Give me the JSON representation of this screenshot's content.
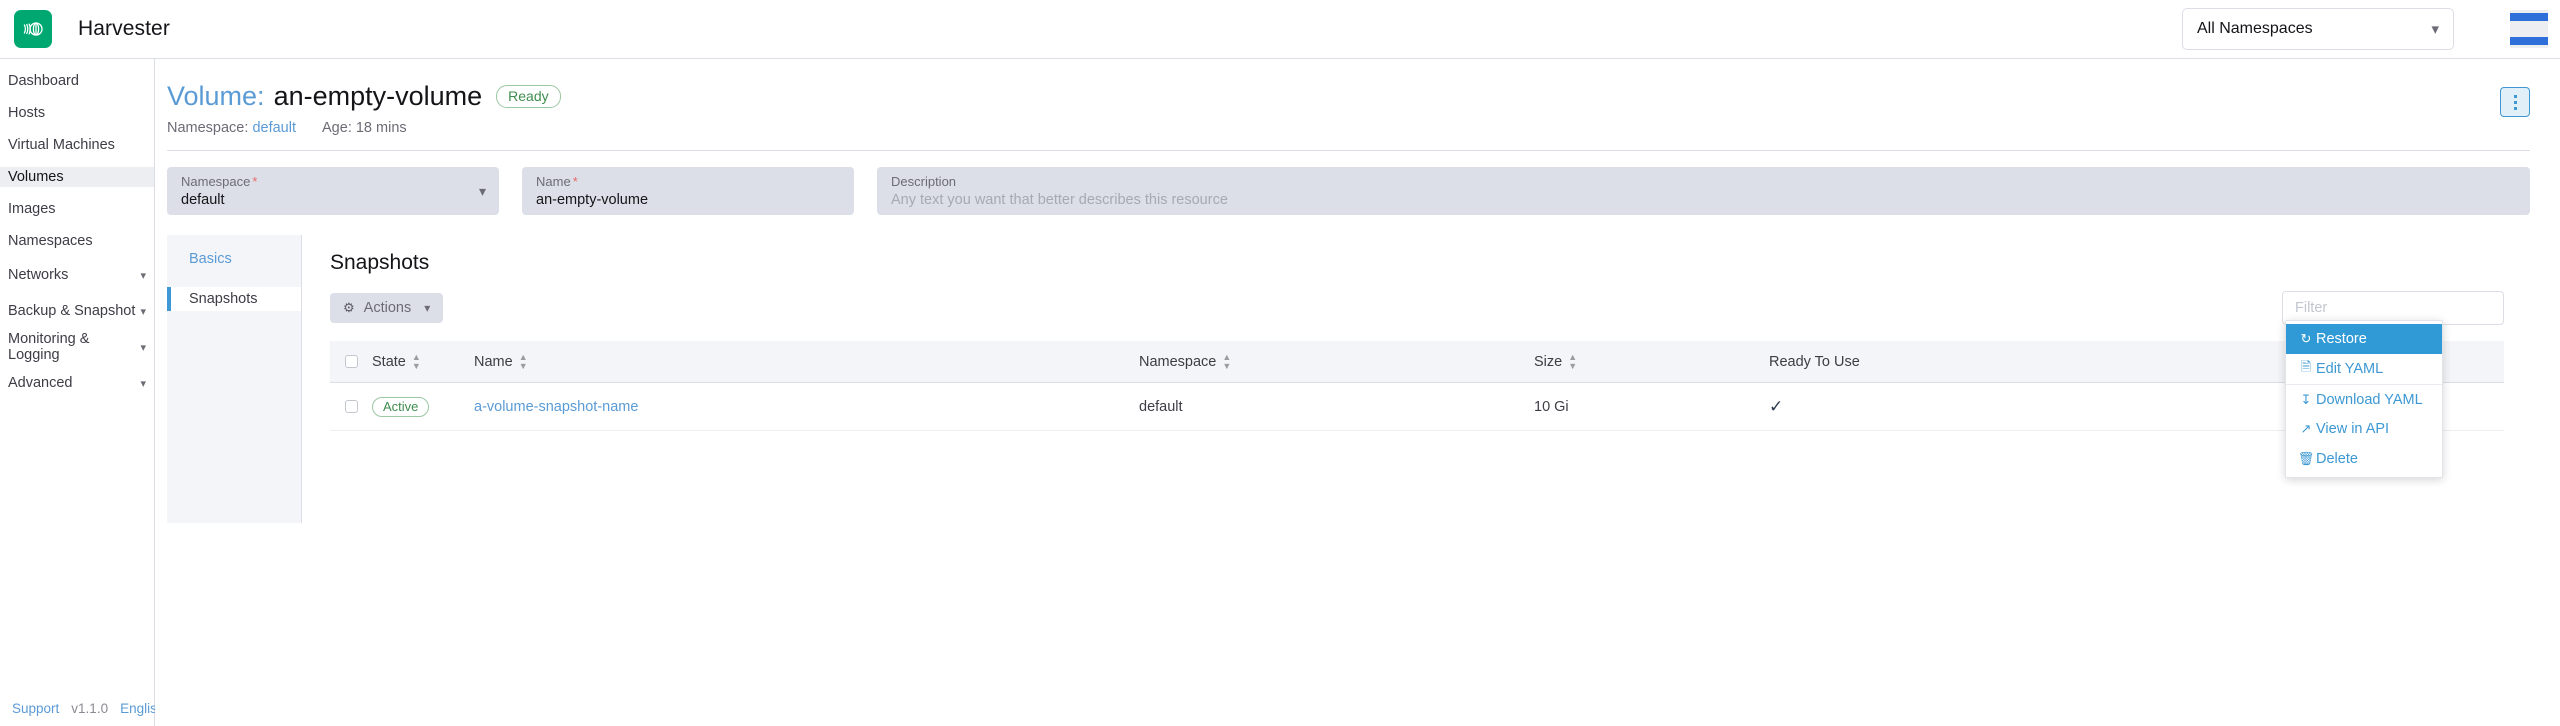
{
  "topbar": {
    "logo_icon": "harvester-logo-icon",
    "brand": "Harvester",
    "namespace_filter": {
      "value": "All Namespaces",
      "chevron_icon": "chevron-down-icon"
    },
    "brand_color": "#00a871"
  },
  "sidebar": {
    "items": [
      {
        "label": "Dashboard",
        "active": false,
        "expandable": false
      },
      {
        "label": "Hosts",
        "active": false,
        "expandable": false
      },
      {
        "label": "Virtual Machines",
        "active": false,
        "expandable": false
      },
      {
        "label": "Volumes",
        "active": true,
        "expandable": false
      },
      {
        "label": "Images",
        "active": false,
        "expandable": false
      },
      {
        "label": "Namespaces",
        "active": false,
        "expandable": false
      },
      {
        "label": "Networks",
        "active": false,
        "expandable": true
      },
      {
        "label": "Backup & Snapshot",
        "active": false,
        "expandable": true
      },
      {
        "label": "Monitoring & Logging",
        "active": false,
        "expandable": true
      },
      {
        "label": "Advanced",
        "active": false,
        "expandable": true
      }
    ],
    "footer": {
      "support": "Support",
      "version": "v1.1.0",
      "language": "English"
    }
  },
  "header": {
    "kind": "Volume:",
    "name": "an-empty-volume",
    "state_badge": "Ready",
    "namespace_label": "Namespace:",
    "namespace_value": "default",
    "age": "Age: 18 mins",
    "kebab_icon": "kebab-menu-icon"
  },
  "form": {
    "namespace": {
      "label": "Namespace",
      "required": "*",
      "value": "default",
      "chevron_icon": "chevron-down-icon"
    },
    "name": {
      "label": "Name",
      "required": "*",
      "value": "an-empty-volume"
    },
    "description": {
      "label": "Description",
      "placeholder": "Any text you want that better describes this resource",
      "value": ""
    }
  },
  "panel": {
    "tabs": [
      {
        "label": "Basics",
        "active": false
      },
      {
        "label": "Snapshots",
        "active": true
      }
    ],
    "title": "Snapshots",
    "actions_button": {
      "label": "Actions",
      "gear_icon": "gear-icon",
      "chevron_icon": "chevron-down-icon"
    },
    "filter": {
      "placeholder": "Filter",
      "value": ""
    }
  },
  "table": {
    "columns": [
      {
        "label": "State",
        "sortable": true
      },
      {
        "label": "Name",
        "sortable": true
      },
      {
        "label": "Namespace",
        "sortable": true
      },
      {
        "label": "Size",
        "sortable": true
      },
      {
        "label": "Ready To Use",
        "sortable": false
      }
    ],
    "rows": [
      {
        "selected": false,
        "state": "Active",
        "name": "a-volume-snapshot-name",
        "namespace": "default",
        "size": "10 Gi",
        "ready_to_use": "✓"
      }
    ]
  },
  "context_menu": {
    "items": [
      {
        "label": "Restore",
        "icon": "restore-icon",
        "selected": true,
        "separator": false
      },
      {
        "label": "Edit YAML",
        "icon": "file-icon",
        "selected": false,
        "separator": false
      },
      {
        "label": "Download YAML",
        "icon": "download-icon",
        "selected": false,
        "separator": true
      },
      {
        "label": "View in API",
        "icon": "external-link-icon",
        "selected": false,
        "separator": false
      },
      {
        "label": "Delete",
        "icon": "trash-icon",
        "selected": false,
        "separator": false
      }
    ]
  },
  "colors": {
    "accent_blue": "#3d98d3",
    "link_blue": "#5b9bd5",
    "success_green": "#3f8d4e",
    "menu_highlight": "#2f9ad6"
  }
}
